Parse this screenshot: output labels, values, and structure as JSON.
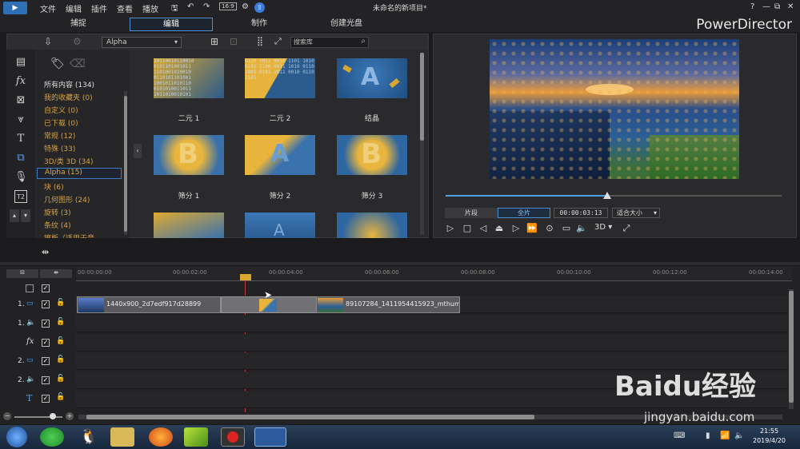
{
  "menu": {
    "items": [
      "文件",
      "编辑",
      "插件",
      "查看",
      "播放"
    ],
    "project_title": "未命名的新项目*",
    "window_controls": [
      "?",
      "—",
      "⧉",
      "✕"
    ]
  },
  "tabs": [
    {
      "label": "捕捉"
    },
    {
      "label": "编辑",
      "active": true
    },
    {
      "label": "制作"
    },
    {
      "label": "创建光盘"
    }
  ],
  "brand": "PowerDirector",
  "library": {
    "filter": "Alpha",
    "search_placeholder": "搜索库",
    "categories": [
      {
        "label": "所有内容 (134)"
      },
      {
        "label": "我的收藏夹  (0)"
      },
      {
        "label": "自定义  (0)"
      },
      {
        "label": "已下载  (0)"
      },
      {
        "label": "常规  (12)"
      },
      {
        "label": "特殊  (33)"
      },
      {
        "label": "3D/类 3D  (34)"
      },
      {
        "label": "Alpha  (15)"
      },
      {
        "label": "块  (6)"
      },
      {
        "label": "几何图形  (24)"
      },
      {
        "label": "旋转  (3)"
      },
      {
        "label": "条纹  (4)"
      },
      {
        "label": "擦板（适用于音..."
      }
    ],
    "thumbnails": [
      {
        "caption": "二元 1"
      },
      {
        "caption": "二元 2"
      },
      {
        "caption": "结晶"
      },
      {
        "caption": "筛分 1"
      },
      {
        "caption": "筛分 2"
      },
      {
        "caption": "筛分 3"
      }
    ]
  },
  "preview": {
    "mode_clip": "片段",
    "mode_movie": "全片",
    "timecode": "00:00:03:13",
    "fit": "适合大小",
    "dim_3d": "3D",
    "progress": 0.48
  },
  "timeline": {
    "ruler": [
      "00:00:00:00",
      "00:00:02:00",
      "00:00:04:00",
      "00:00:06:00",
      "00:00:08:00",
      "00:00:10:00",
      "00:00:12:00",
      "00:00:14:00"
    ],
    "tracks": [
      {
        "label": "1."
      },
      {
        "label": "1."
      },
      {
        "label": "fx"
      },
      {
        "label": "2."
      },
      {
        "label": "2."
      },
      {
        "label": "T"
      }
    ],
    "clip1": "1440x900_2d7edf917d28899",
    "clip2": "89107284_1411954415923_mthum"
  },
  "taskbar": {
    "time": "21:55",
    "date": "2019/4/20"
  },
  "watermark": {
    "brand": "Baidu经验",
    "url": "jingyan.baidu.com"
  }
}
